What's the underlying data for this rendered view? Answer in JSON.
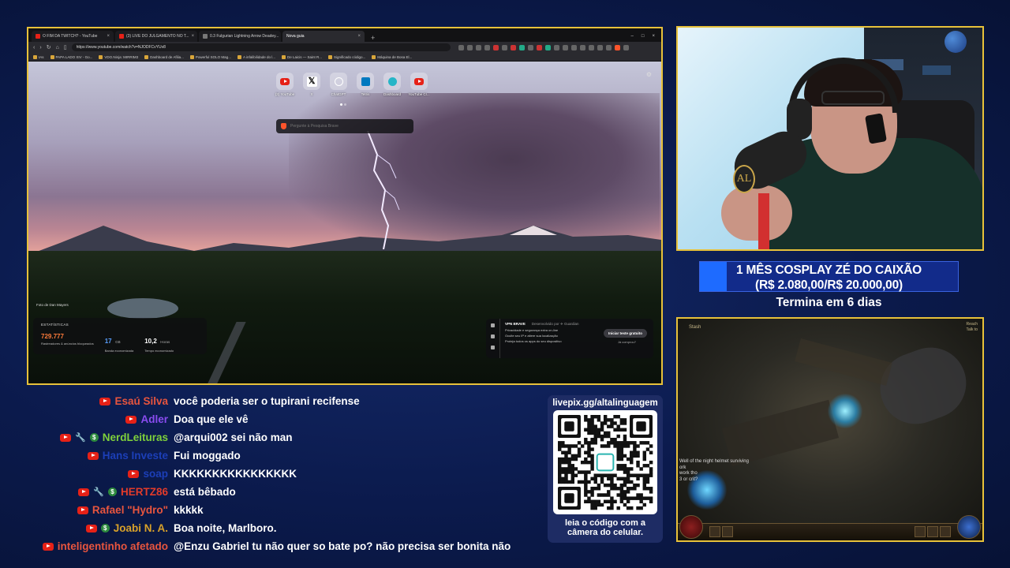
{
  "browser": {
    "tabs": [
      {
        "label": "O FIM DA TWITCH? - YouTube",
        "icon": "youtube-icon",
        "active": false
      },
      {
        "label": "(3) LIVE DO JULGAMENTO NO T...",
        "icon": "youtube-icon",
        "active": false
      },
      {
        "label": "0.3 Fulgurian Lightning Arrow Deadey...",
        "icon": "page-icon",
        "active": false
      },
      {
        "label": "Nova guia",
        "icon": "brave-icon",
        "active": true
      }
    ],
    "address": "https://www.youtube.com/watch?v=NJODFCvYUv8",
    "bookmarks": [
      "IAs",
      "PAPA LADO XIV - Go...",
      "VDO.Ninja: MIRRIM3",
      "Dashboard de Afilia...",
      "Powerful SOLO Mag...",
      "A infalibilidade do l...",
      "De Laicis — Saint R...",
      "Significado código...",
      "Máquina de Bosa El..."
    ],
    "shortcuts": [
      {
        "label": "(3) YouTube",
        "icon": "youtube-icon"
      },
      {
        "label": "X",
        "icon": "x-icon"
      },
      {
        "label": "ChatGPT",
        "icon": "chatgpt-icon"
      },
      {
        "label": "Tetris",
        "icon": "tetris-icon"
      },
      {
        "label": "Dashboard",
        "icon": "dashboard-icon"
      },
      {
        "label": "YouTube Cr...",
        "icon": "youtube-icon"
      }
    ],
    "search_placeholder": "Pergunte à Pesquisa Brave",
    "photo_credit": "Foto de Dan Mayers",
    "stats": {
      "title": "ESTATÍSTICAS",
      "items": [
        {
          "value": "729.777",
          "unit": "",
          "caption": "Rastreadores & anúncios bloqueados",
          "color": "#fb7a3a"
        },
        {
          "value": "17",
          "unit": "GB",
          "caption": "Banda economizada",
          "color": "#5aa0ff"
        },
        {
          "value": "10,2",
          "unit": "Horas",
          "caption": "Tempo economizado",
          "color": "#ffffff"
        }
      ]
    },
    "vpn": {
      "title": "VPN BRAVE",
      "subtitle": "Desenvolvido por ✈ Guardian",
      "lines": [
        "Privacidade e segurança extra on-line",
        "Oculte seu IP e altere sua localização",
        "Proteja todos os apps do seu dispositivo"
      ],
      "button": "Iniciar teste gratuito",
      "link": "Já comprou?"
    }
  },
  "goal": {
    "title": "1 MÊS COSPLAY ZÉ DO CAIXÃO",
    "amount": "(R$ 2.080,00/R$ 20.000,00)",
    "progress": 0.104,
    "ends": "Termina em 6 dias",
    "fill_color": "#1e6bff"
  },
  "qr": {
    "url": "livepix.gg/altalinguagem",
    "caption_line1": "leia o código com a",
    "caption_line2": "câmera do celular."
  },
  "game": {
    "stash_label": "Stash",
    "right_labels": [
      "Reach",
      "Talk to"
    ],
    "chat_lines": [
      "Well of the night helmet surviving",
      "ork",
      "work tho",
      "3 or crit?"
    ]
  },
  "webcam": {
    "mic_badge": "AL"
  },
  "chat": [
    {
      "name": "Esaú Silva",
      "color": "#e8553e",
      "badges": [
        "youtube-icon"
      ],
      "text": "você poderia ser o tupirani recifense"
    },
    {
      "name": "Adler",
      "color": "#8a4cf0",
      "badges": [
        "youtube-icon"
      ],
      "text": "Doa que ele vê"
    },
    {
      "name": "NerdLeituras",
      "color": "#7fd13b",
      "badges": [
        "youtube-icon",
        "wrench-icon",
        "money-icon"
      ],
      "text": "@arqui002 sei não man"
    },
    {
      "name": "Hans Investe",
      "color": "#1c3fb8",
      "badges": [
        "youtube-icon"
      ],
      "text": "Fui moggado"
    },
    {
      "name": "soap",
      "color": "#1c3fb8",
      "badges": [
        "youtube-icon"
      ],
      "text": "KKKKKKKKKKKKKKKK"
    },
    {
      "name": "HERTZ86",
      "color": "#e23b2a",
      "badges": [
        "youtube-icon",
        "wrench-icon",
        "money-icon"
      ],
      "text": "está bêbado"
    },
    {
      "name": "Rafael \"Hydro\"",
      "color": "#e8553e",
      "badges": [
        "youtube-icon"
      ],
      "text": "kkkkk"
    },
    {
      "name": "Joabi N. A.",
      "color": "#d8a12a",
      "badges": [
        "youtube-icon",
        "money-icon"
      ],
      "text": "Boa noite, Marlboro."
    },
    {
      "name": "inteligentinho afetado",
      "color": "#e8553e",
      "badges": [
        "youtube-icon"
      ],
      "text": "@Enzu Gabriel tu não quer so bate po? não precisa ser bonita não"
    }
  ]
}
